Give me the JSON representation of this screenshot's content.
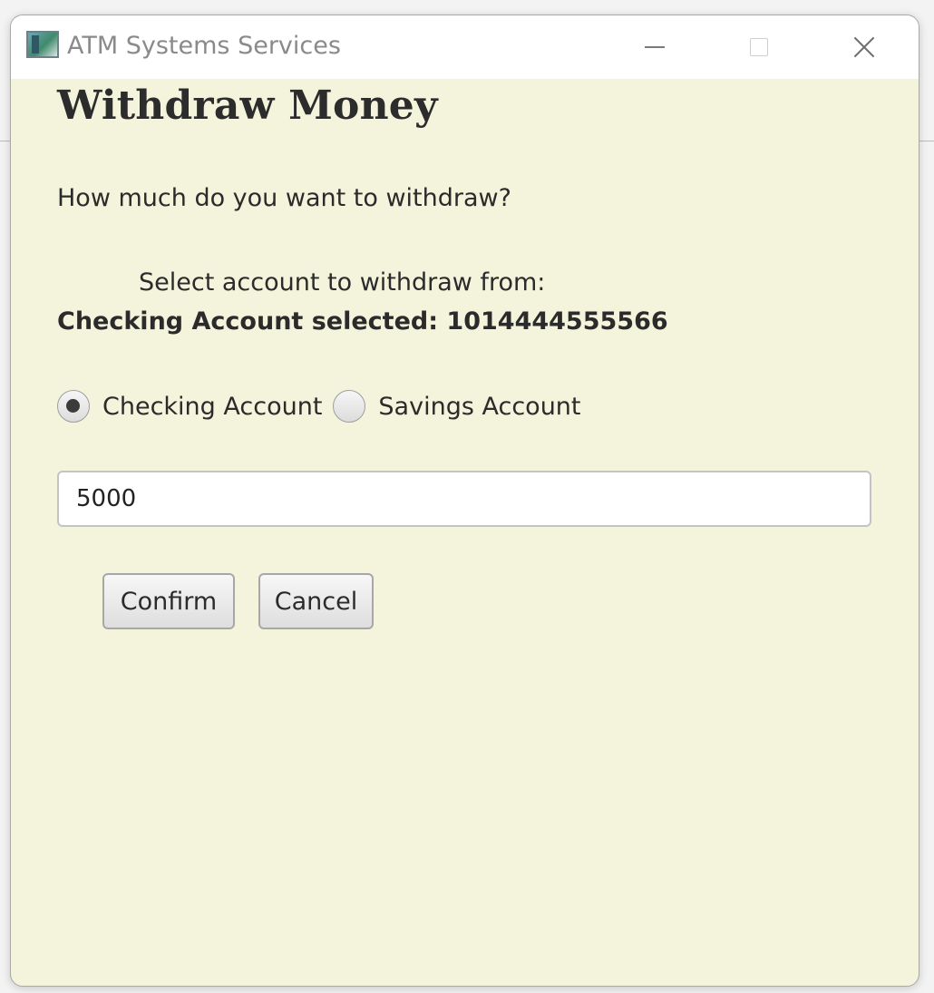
{
  "window": {
    "title": "ATM Systems Services",
    "icon": "app-icon",
    "controls": {
      "minimize_icon": "minimize-icon",
      "maximize_icon": "maximize-icon",
      "close_icon": "close-icon"
    }
  },
  "dialog": {
    "heading": "Withdraw Money",
    "question": "How much do you want to withdraw?",
    "select_label": "Select account to withdraw from:",
    "selected_info": "Checking Account selected: 1014444555566",
    "accounts": [
      {
        "label": "Checking Account",
        "checked": true
      },
      {
        "label": "Savings Account",
        "checked": false
      }
    ],
    "amount": {
      "value": "5000",
      "placeholder": ""
    },
    "buttons": {
      "confirm": "Confirm",
      "cancel": "Cancel"
    }
  },
  "colors": {
    "dialog_background": "#f4f3db",
    "titlebar_background": "#ffffff"
  }
}
